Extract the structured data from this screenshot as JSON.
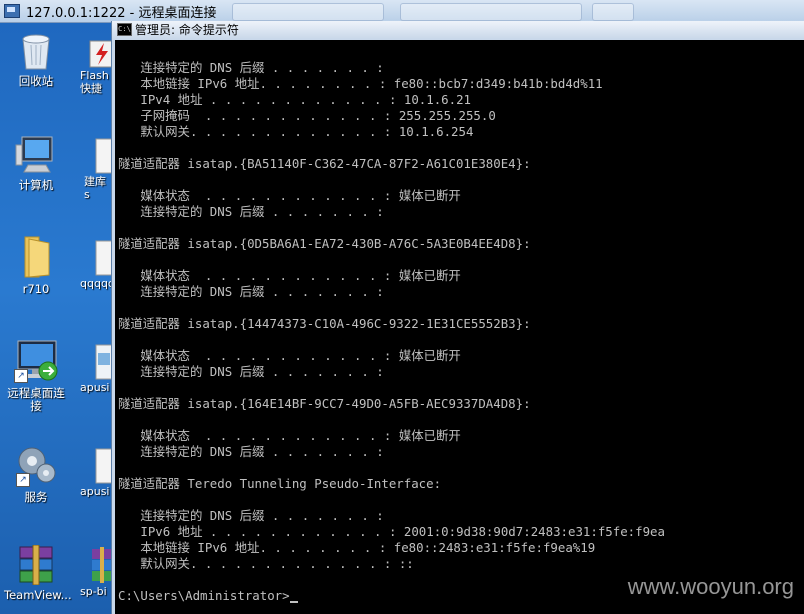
{
  "remote_window": {
    "title": "127.0.0.1:1222 - 远程桌面连接"
  },
  "desktop": {
    "icons": [
      {
        "label": "回收站",
        "icon": "recycle-bin-icon"
      },
      {
        "label": "计算机",
        "icon": "computer-icon"
      },
      {
        "label": "r710",
        "icon": "folder-icon"
      },
      {
        "label": "远程桌面连接",
        "icon": "remote-desktop-icon"
      },
      {
        "label": "服务",
        "icon": "services-gear-icon"
      },
      {
        "label": "TeamView...",
        "icon": "winrar-icon"
      }
    ],
    "partial_icons": [
      {
        "label": "Flash 快捷",
        "icon": "flash-shortcut-icon"
      },
      {
        "label": "建库 s",
        "icon": "text-file-icon"
      },
      {
        "label": "qqqqq",
        "icon": "text-file-icon"
      },
      {
        "label": "apusi",
        "icon": "image-file-icon"
      },
      {
        "label": "apusi",
        "icon": "text-file-icon"
      },
      {
        "label": "sp-bi",
        "icon": "winrar-icon"
      }
    ]
  },
  "cmd": {
    "title": "管理员: 命令提示符",
    "lines": [
      "   连接特定的 DNS 后缀 . . . . . . . :",
      "   本地链接 IPv6 地址. . . . . . . . : fe80::bcb7:d349:b41b:bd4d%11",
      "   IPv4 地址 . . . . . . . . . . . . : 10.1.6.21",
      "   子网掩码  . . . . . . . . . . . . : 255.255.255.0",
      "   默认网关. . . . . . . . . . . . . : 10.1.6.254",
      "",
      "隧道适配器 isatap.{BA51140F-C362-47CA-87F2-A61C01E380E4}:",
      "",
      "   媒体状态  . . . . . . . . . . . . : 媒体已断开",
      "   连接特定的 DNS 后缀 . . . . . . . :",
      "",
      "隧道适配器 isatap.{0D5BA6A1-EA72-430B-A76C-5A3E0B4EE4D8}:",
      "",
      "   媒体状态  . . . . . . . . . . . . : 媒体已断开",
      "   连接特定的 DNS 后缀 . . . . . . . :",
      "",
      "隧道适配器 isatap.{14474373-C10A-496C-9322-1E31CE5552B3}:",
      "",
      "   媒体状态  . . . . . . . . . . . . : 媒体已断开",
      "   连接特定的 DNS 后缀 . . . . . . . :",
      "",
      "隧道适配器 isatap.{164E14BF-9CC7-49D0-A5FB-AEC9337DA4D8}:",
      "",
      "   媒体状态  . . . . . . . . . . . . : 媒体已断开",
      "   连接特定的 DNS 后缀 . . . . . . . :",
      "",
      "隧道适配器 Teredo Tunneling Pseudo-Interface:",
      "",
      "   连接特定的 DNS 后缀 . . . . . . . :",
      "   IPv6 地址 . . . . . . . . . . . . : 2001:0:9d38:90d7:2483:e31:f5fe:f9ea",
      "   本地链接 IPv6 地址. . . . . . . . : fe80::2483:e31:f5fe:f9ea%19",
      "   默认网关. . . . . . . . . . . . . : ::",
      "",
      "C:\\Users\\Administrator>"
    ]
  },
  "watermark": "www.wooyun.org"
}
